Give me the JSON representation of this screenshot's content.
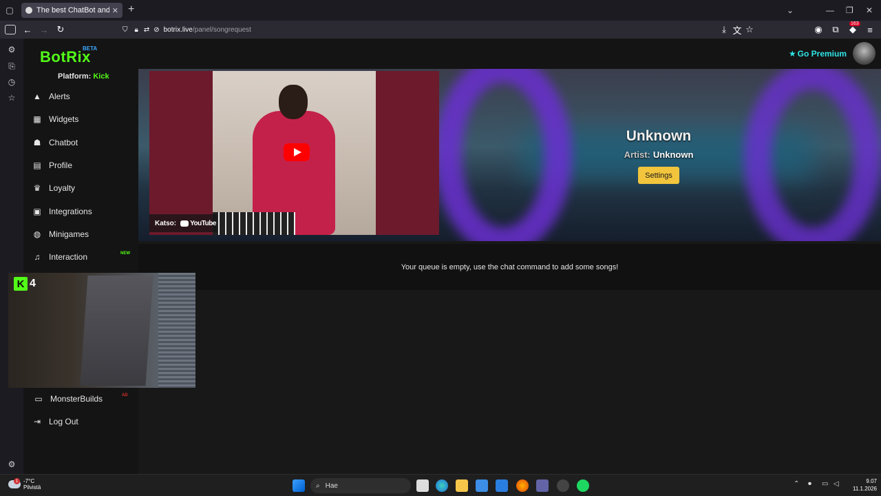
{
  "browser": {
    "tab_title": "The best ChatBot and Widgets",
    "url_host": "botrix.live",
    "url_path": "/panel/songrequest",
    "extension_badge": "163"
  },
  "app": {
    "logo": "BotRix",
    "logo_badge": "BETA",
    "premium_label": "Go Premium",
    "platform_label": "Platform:",
    "platform_value": "Kick"
  },
  "nav": [
    {
      "label": "Alerts",
      "icon": "warning-icon"
    },
    {
      "label": "Widgets",
      "icon": "widgets-icon"
    },
    {
      "label": "Chatbot",
      "icon": "robot-icon"
    },
    {
      "label": "Profile",
      "icon": "id-card-icon"
    },
    {
      "label": "Loyalty",
      "icon": "trophy-icon"
    },
    {
      "label": "Integrations",
      "icon": "integrations-icon"
    },
    {
      "label": "Minigames",
      "icon": "gamepad-icon"
    },
    {
      "label": "Interaction",
      "icon": "music-icon",
      "badge": "NEW"
    },
    {
      "label": "MonsterBuilds",
      "icon": "laptop-icon",
      "badge": "AD"
    },
    {
      "label": "Log Out",
      "icon": "logout-icon"
    }
  ],
  "player": {
    "song_title": "Unknown",
    "artist_label": "Artist:",
    "artist_value": "Unknown",
    "settings_label": "Settings",
    "watch_label": "Katso:",
    "youtube_label": "YouTube"
  },
  "queue": {
    "empty_message": "Your queue is empty, use the chat command to add some songs!"
  },
  "overlay": {
    "platform_letter": "K",
    "viewer_count": "4"
  },
  "taskbar": {
    "temperature": "-7°C",
    "weather": "Pilvistä",
    "weather_alert": "1",
    "search_placeholder": "Hae",
    "time": "9.07",
    "date": "11.1.2026"
  }
}
